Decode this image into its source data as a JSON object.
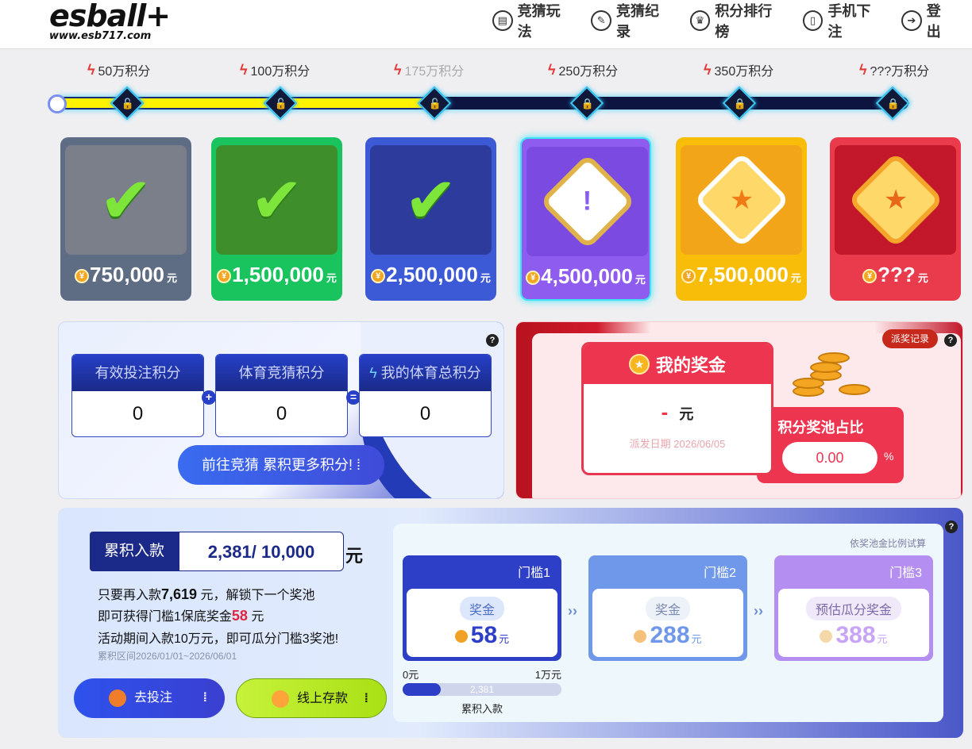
{
  "header": {
    "logo_text": "esball+",
    "logo_url": "www.esb717.com",
    "nav": [
      {
        "icon": "book-icon",
        "glyph": "▤",
        "label": "竞猜玩法"
      },
      {
        "icon": "note-icon",
        "glyph": "✎",
        "label": "竞猜纪录"
      },
      {
        "icon": "trophy-icon",
        "glyph": "♛",
        "label": "积分排行榜"
      },
      {
        "icon": "phone-icon",
        "glyph": "▯",
        "label": "手机下注"
      },
      {
        "icon": "logout-icon",
        "glyph": "➔",
        "label": "登出"
      }
    ]
  },
  "milestones": [
    {
      "label": "50万积分",
      "dim": false
    },
    {
      "label": "100万积分",
      "dim": false
    },
    {
      "label": "175万积分",
      "dim": true
    },
    {
      "label": "250万积分",
      "dim": false
    },
    {
      "label": "350万积分",
      "dim": false
    },
    {
      "label": "???万积分",
      "dim": false
    }
  ],
  "progress_fraction": 0.45,
  "tiers": [
    {
      "amount": "750,000",
      "unit": "元",
      "status": "claimed",
      "color": "#5e6d84"
    },
    {
      "amount": "1,500,000",
      "unit": "元",
      "status": "claimed",
      "color": "#19c45f"
    },
    {
      "amount": "2,500,000",
      "unit": "元",
      "status": "claimed",
      "color": "#3d5ad6"
    },
    {
      "amount": "4,500,000",
      "unit": "元",
      "status": "active",
      "color": "#8f5cf0"
    },
    {
      "amount": "7,500,000",
      "unit": "元",
      "status": "locked",
      "color": "#f8bd09"
    },
    {
      "amount": "???",
      "unit": "元",
      "status": "locked",
      "color": "#e93b4b"
    }
  ],
  "scores": {
    "valid_bet_label": "有效投注积分",
    "valid_bet_value": "0",
    "sports_label": "体育竞猜积分",
    "sports_value": "0",
    "total_label": "我的体育总积分",
    "total_value": "0",
    "plus": "+",
    "equals": "=",
    "go_button": "前往竞猜 累积更多积分!"
  },
  "bonus": {
    "title": "我的奖金",
    "value": "-",
    "unit": "元",
    "date_label": "派发日期 2026/06/05",
    "ratio_label": "积分奖池占比",
    "ratio_value": "0.00",
    "ratio_unit": "%",
    "record_button": "派奖记录"
  },
  "deposit": {
    "label": "累积入款",
    "value": "2,381/ 10,000",
    "unit": "元",
    "line1_pre": "只要再入款",
    "line1_num": "7,619",
    "line1_post": " 元，解锁下一个奖池",
    "line2_pre": "即可获得门槛1保底奖金",
    "line2_num": "58",
    "line2_post": " 元",
    "line3": "活动期间入款10万元，即可瓜分门槛3奖池!",
    "period": "累积区间2026/01/01~2026/06/01",
    "bet_button": "去投注",
    "deposit_button": "线上存款"
  },
  "thresholds": {
    "note": "依奖池金比例试算",
    "items": [
      {
        "title": "门槛1",
        "tag": "奖金",
        "amount": "58",
        "unit": "元",
        "color": "#2d3fc7"
      },
      {
        "title": "门槛2",
        "tag": "奖金",
        "amount": "288",
        "unit": "元",
        "color": "#6f98ea"
      },
      {
        "title": "门槛3",
        "tag": "预估瓜分奖金",
        "amount": "388",
        "unit": "元",
        "color": "#b48ef0"
      }
    ],
    "bar_start": "0元",
    "bar_end": "1万元",
    "bar_value": "2,381",
    "bar_fraction": 0.2381,
    "bar_caption": "累积入款"
  }
}
